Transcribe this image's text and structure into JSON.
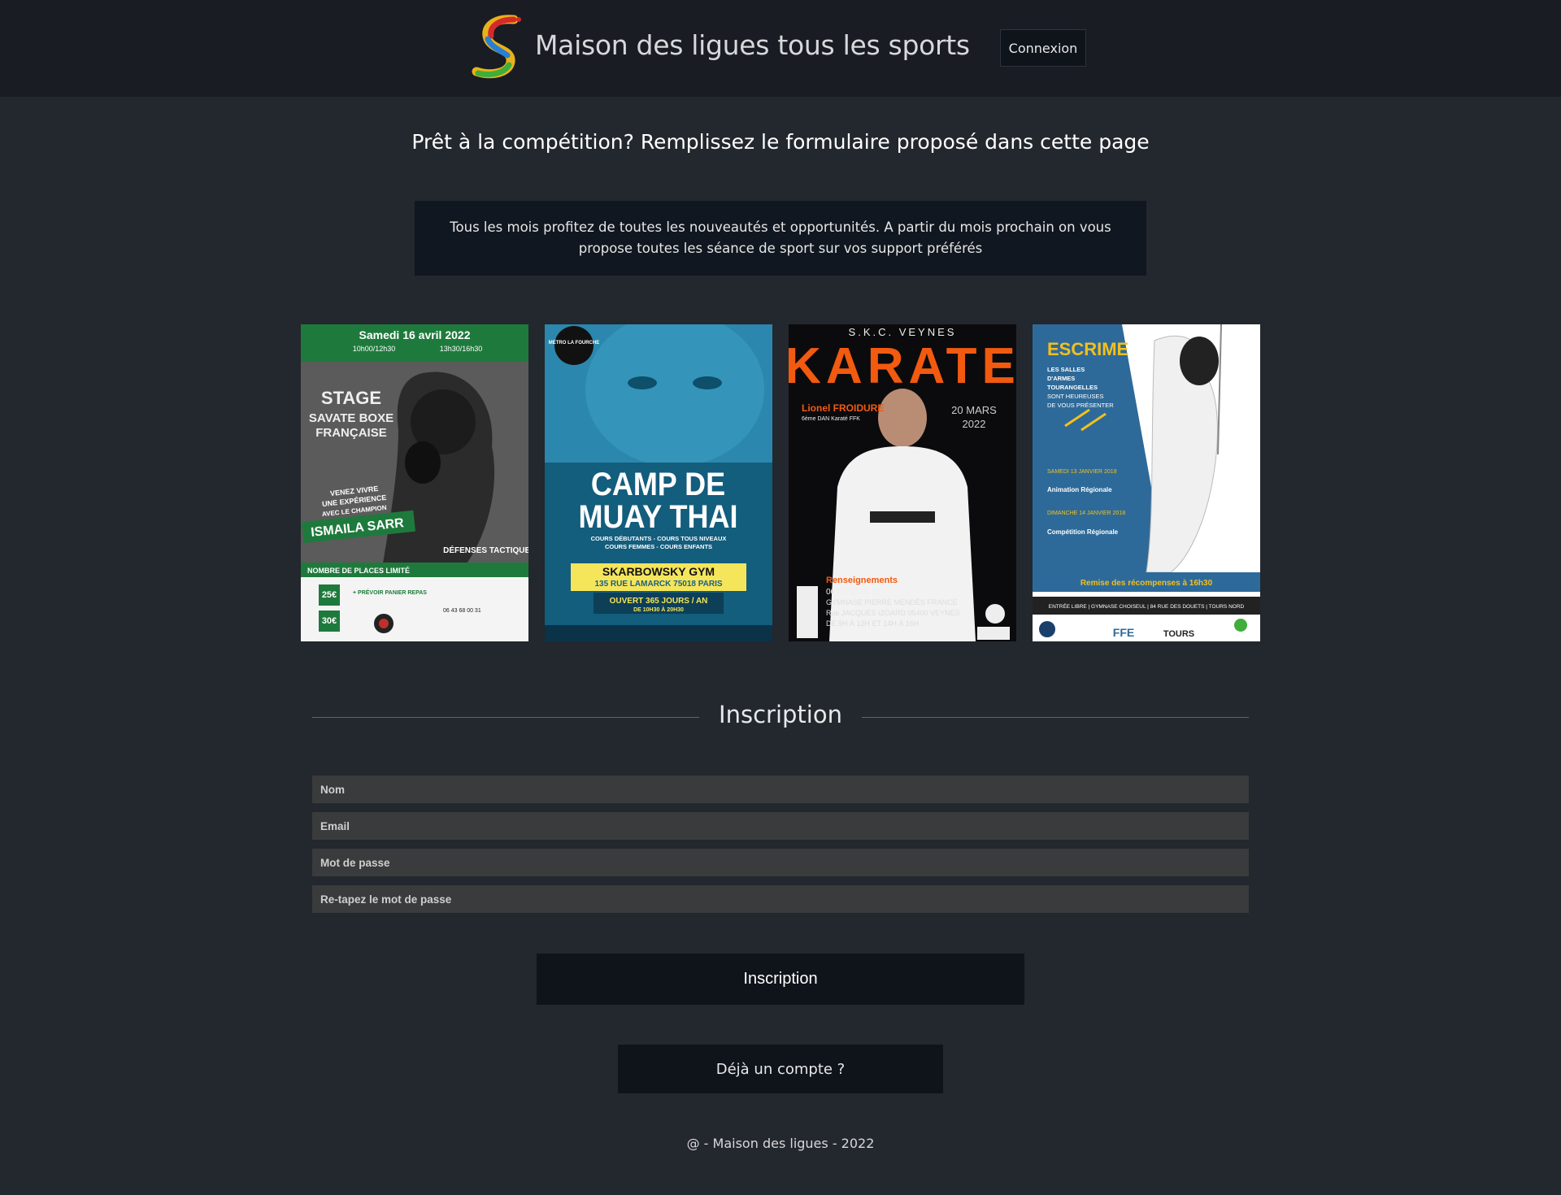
{
  "header": {
    "title": "Maison des ligues tous les sports",
    "login_label": "Connexion"
  },
  "heading": "Prêt à la compétition? Remplissez le formulaire proposé dans cette page",
  "notice": "Tous les mois profitez de toutes les nouveautés et opportunités. A partir du mois prochain on vous propose toutes les séance de sport sur vos support préférés",
  "posters": [
    {
      "date": "Samedi 16 avril 2022",
      "times": [
        "10h00/12h30",
        "13h30/16h30"
      ],
      "lines": [
        "STAGE",
        "SAVATE BOXE",
        "FRANÇAISE"
      ],
      "tagline": [
        "VENEZ VIVRE",
        "UNE EXPÉRIENCE",
        "AVEC LE CHAMPION"
      ],
      "champion": "ISMAILA SARR",
      "brand": "DÉFENSES TACTIQUES",
      "limited": "NOMBRE DE PLACES LIMITÉ",
      "prices": [
        "25€",
        "30€"
      ],
      "extra": "+ PRÉVOIR PANIER REPAS",
      "phone": "06 43 68 00 31"
    },
    {
      "metro": "METRO LA FOURCHE",
      "title_lines": [
        "CAMP DE",
        "MUAY THAI"
      ],
      "courses": [
        "COURS DÉBUTANTS - COURS TOUS NIVEAUX",
        "COURS FEMMES - COURS ENFANTS"
      ],
      "gym": "SKARBOWSKY GYM",
      "address": "135 RUE LAMARCK 75018 PARIS",
      "open": "OUVERT 365 JOURS / AN",
      "hours": "DE 10H30 À 20H30"
    },
    {
      "club": "S.K.C. VEYNES",
      "title": "KARATE",
      "instructor": "Lionel FROIDURE",
      "rank": "6ème DAN Karaté FFK",
      "date_lines": [
        "20 MARS",
        "2022"
      ],
      "info_title": "Renseignements",
      "info_lines": [
        "06 09 30 05 74",
        "GYMNASE PIERRE MENDÈS FRANCE",
        "Rue JACQUES IZOARD 05400 VEYNES",
        "DE 9H À 12H ET 14H À 16H"
      ]
    },
    {
      "title": "ESCRIME",
      "intro_lines": [
        "LES SALLES",
        "D'ARMES",
        "TOURANGELLES",
        "SONT HEUREUSES",
        "DE VOUS PRÉSENTER"
      ],
      "event1": "SAMEDI 13 JANVIER 2018",
      "event1_title": "Animation Régionale",
      "event2": "DIMANCHE 14 JANVIER 2018",
      "event2_title": "Compétition Régionale",
      "awards": "Remise des récompenses à 16h30",
      "entry": "ENTRÉE LIBRE | GYMNASE CHOISEUL | 84 RUE DES DOUETS | TOURS NORD",
      "sponsors": [
        "FFE",
        "TOURS"
      ]
    }
  ],
  "form": {
    "section_title": "Inscription",
    "fields": [
      {
        "placeholder": "Nom"
      },
      {
        "placeholder": "Email"
      },
      {
        "placeholder": "Mot de passe"
      },
      {
        "placeholder": "Re-tapez le mot de passe"
      }
    ],
    "submit_label": "Inscription",
    "account_label": "Déjà un compte ?"
  },
  "footer": "@ - Maison des ligues - 2022",
  "colors": {
    "background": "#23272e",
    "header": "#191c22",
    "button": "#0f141b",
    "field": "#3a3b3c"
  }
}
